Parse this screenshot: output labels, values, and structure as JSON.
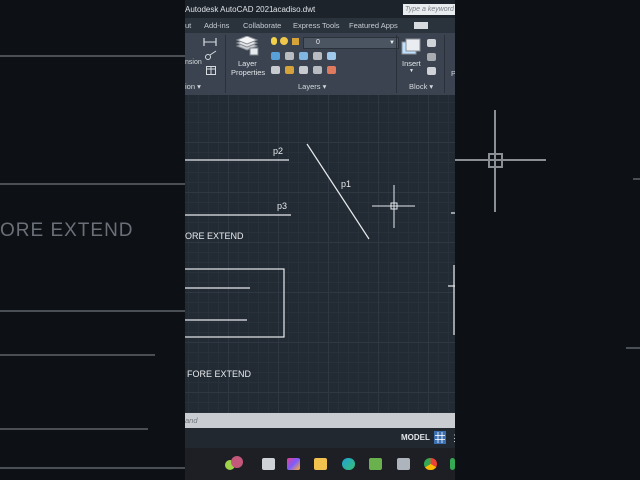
{
  "app": {
    "title": "Autodesk AutoCAD 2021",
    "filename": "acadiso.dwt",
    "search_placeholder": "Type a keyword"
  },
  "menu": [
    "ut",
    "Add-ins",
    "Collaborate",
    "Express Tools",
    "Featured Apps"
  ],
  "ribbon": {
    "layer_properties_label1": "Layer",
    "layer_properties_label2": "Properties",
    "layer_combo_value": "0",
    "insert_label": "Insert",
    "dimension_label": "nsion",
    "panels": {
      "annotation": "ion ▾",
      "layers": "Layers ▾",
      "block": "Block ▾",
      "extra": "P"
    }
  },
  "drawing": {
    "labels": {
      "p1": "p1",
      "p2": "p2",
      "p3": "p3",
      "before_extend_1": "ORE EXTEND",
      "before_extend_2": "FORE EXTEND"
    }
  },
  "background": {
    "caption": "ORE EXTEND"
  },
  "command_line": {
    "text": "and"
  },
  "status": {
    "model_tab": "MODEL"
  },
  "taskbar": {
    "icons": [
      "store-icon",
      "copilot-icon",
      "file-explorer-icon",
      "edge-icon",
      "apps-icon",
      "camera-icon",
      "chrome-icon"
    ]
  },
  "colors": {
    "canvas": "#222a33",
    "ribbon": "#3a434f",
    "accent": "#3b6fb2"
  }
}
